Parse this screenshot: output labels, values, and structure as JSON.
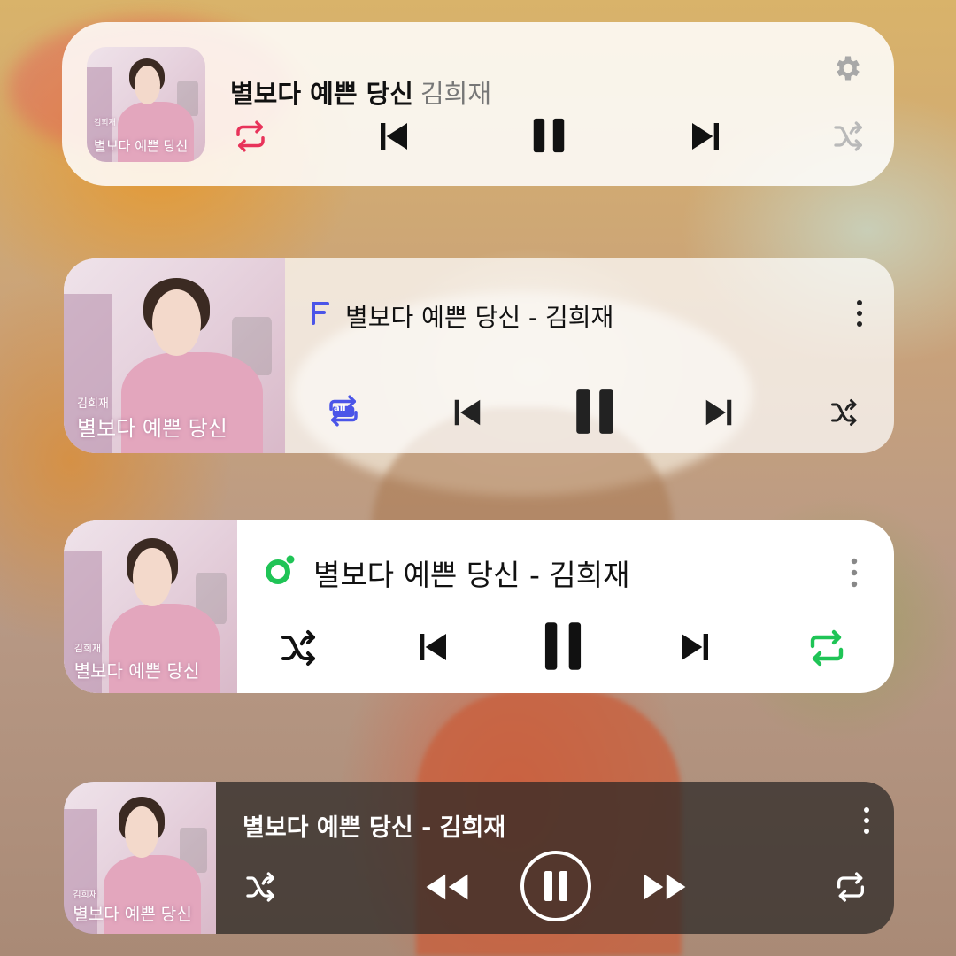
{
  "players": [
    {
      "title": "별보다 예쁜 당신",
      "artist": "김희재",
      "accent_color": "#e8335a",
      "controls": [
        "repeat-icon",
        "skip-previous-icon",
        "pause-icon",
        "skip-next-icon",
        "shuffle-icon"
      ],
      "extra_icon": "gear-icon"
    },
    {
      "title_line": "별보다 예쁜 당신 - 김희재",
      "app_icon": "flo-logo-icon",
      "accent_color": "#4b55e8",
      "repeat_label": "all",
      "controls": [
        "repeat-all-icon",
        "skip-previous-icon",
        "pause-icon",
        "skip-next-icon",
        "shuffle-icon"
      ]
    },
    {
      "title_line": "별보다 예쁜 당신 - 김희재",
      "app_icon": "melon-logo-icon",
      "accent_color": "#1fc456",
      "controls": [
        "shuffle-icon",
        "skip-previous-icon",
        "pause-icon",
        "skip-next-icon",
        "repeat-icon"
      ]
    },
    {
      "title_line": "별보다 예쁜 당신 - 김희재",
      "controls": [
        "shuffle-icon",
        "rewind-icon",
        "pause-circle-icon",
        "fast-forward-icon",
        "repeat-icon"
      ]
    }
  ],
  "album_art": {
    "artist_caption": "김희재",
    "title_caption": "별보다 예쁜 당신"
  }
}
